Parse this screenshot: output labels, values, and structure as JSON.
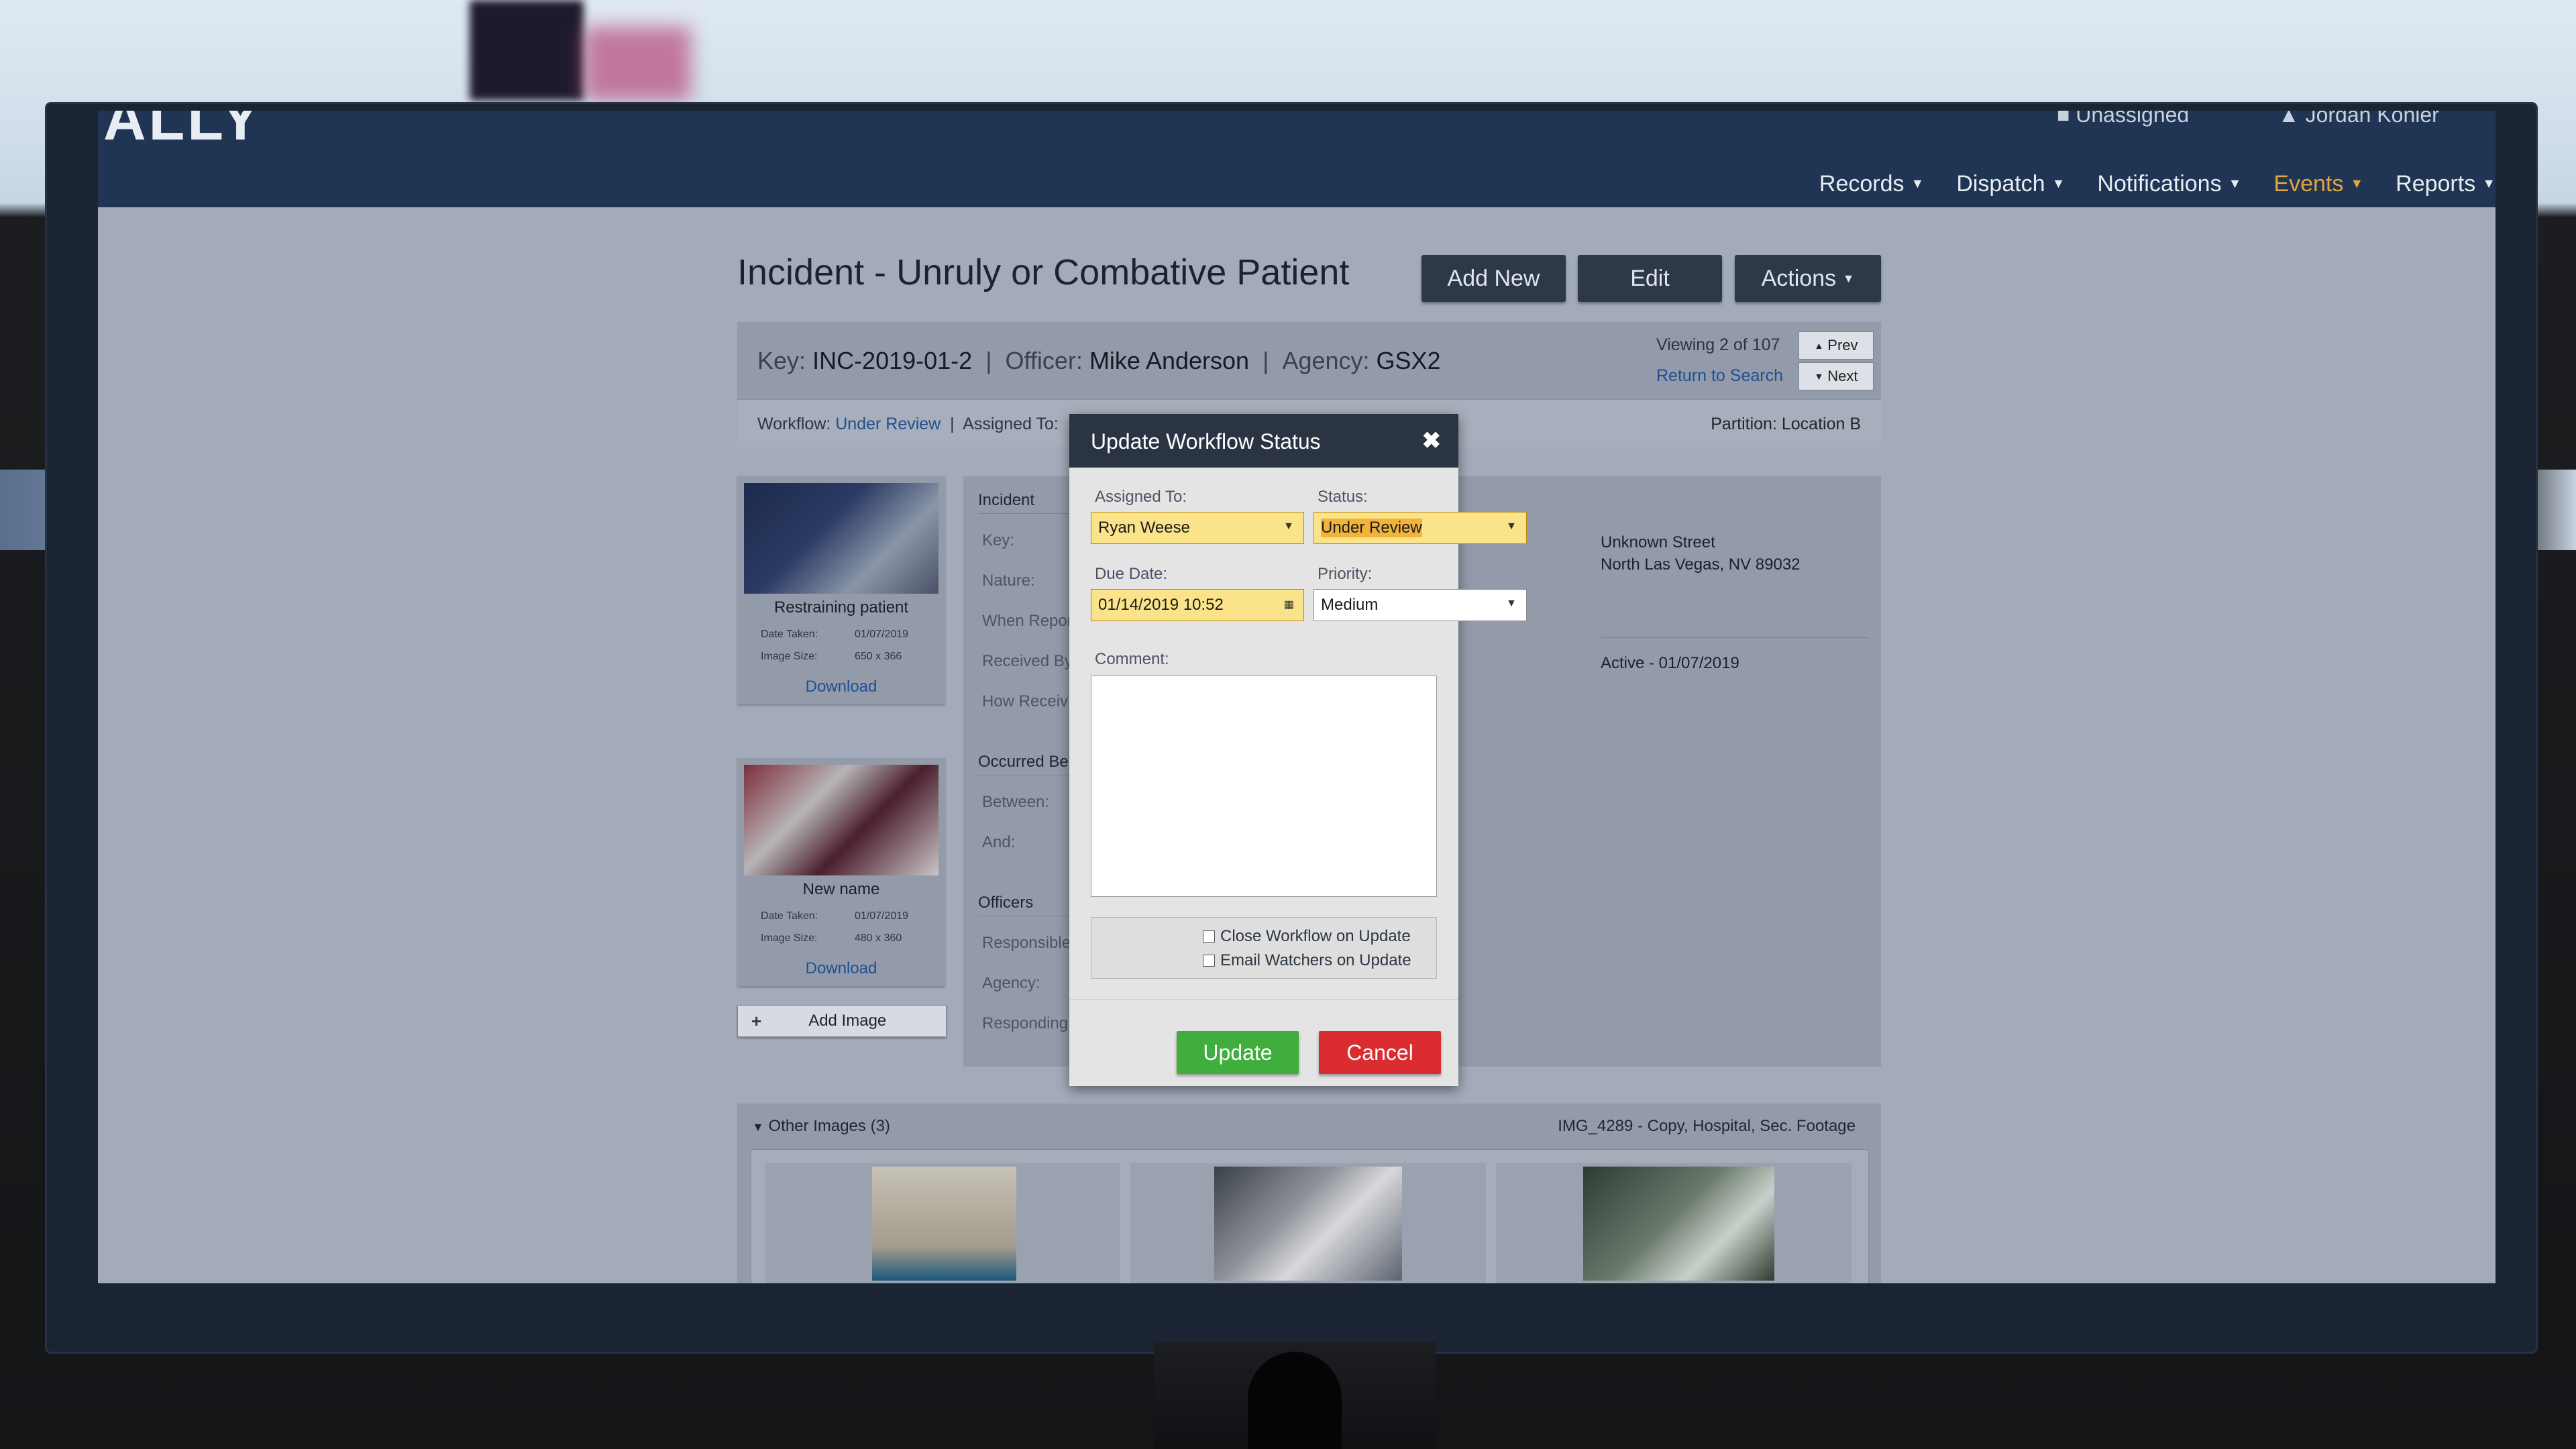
{
  "app": {
    "logo_text": "ALLY",
    "unassigned_label": "Unassigned",
    "user_name": "Jordan Kohler"
  },
  "nav": [
    {
      "label": "Records"
    },
    {
      "label": "Dispatch"
    },
    {
      "label": "Notifications"
    },
    {
      "label": "Events",
      "active": true
    },
    {
      "label": "Reports"
    }
  ],
  "page": {
    "title": "Incident - Unruly or Combative Patient",
    "buttons": {
      "add_new": "Add New",
      "edit": "Edit",
      "actions": "Actions"
    }
  },
  "record": {
    "key_label": "Key:",
    "key_value": "INC-2019-01-2",
    "officer_label": "Officer:",
    "officer_value": "Mike Anderson",
    "agency_label": "Agency:",
    "agency_value": "GSX2",
    "viewing": "Viewing 2 of 107",
    "return_to_search": "Return to Search",
    "prev": "Prev",
    "next": "Next",
    "workflow_label": "Workflow:",
    "workflow_value": "Under Review",
    "assigned_label": "Assigned To:",
    "partition": "Partition: Location B"
  },
  "images": [
    {
      "caption": "Restraining patient",
      "date_label": "Date Taken:",
      "date": "01/07/2019",
      "size_label": "Image Size:",
      "size": "650 x 366",
      "download": "Download"
    },
    {
      "caption": "New name",
      "date_label": "Date Taken:",
      "date": "01/07/2019",
      "size_label": "Image Size:",
      "size": "480 x 360",
      "download": "Download"
    }
  ],
  "add_image": "Add Image",
  "detail": {
    "incident_header": "Incident",
    "key_label": "Key:",
    "nature_label": "Nature:",
    "when_reported_label": "When Repor",
    "received_by_label": "Received By",
    "how_received_label": "How Receiv",
    "occurred_header": "Occurred Be",
    "between_label": "Between:",
    "and_label": "And:",
    "officers_header": "Officers",
    "responsible_label": "Responsible",
    "agency_label": "Agency:",
    "responding_label": "Responding",
    "address_line1": "Unknown Street",
    "address_line2": "North Las Vegas, NV 89032",
    "status_value": "Active - 01/07/2019"
  },
  "other_images": {
    "header": "Other Images",
    "count": "(3)",
    "right_text": "IMG_4289 - Copy, Hospital, Sec. Footage"
  },
  "modal": {
    "title": "Update Workflow Status",
    "assigned_to_label": "Assigned To:",
    "assigned_to_value": "Ryan Weese",
    "status_label": "Status:",
    "status_value": "Under Review",
    "due_date_label": "Due Date:",
    "due_date_value": "01/14/2019 10:52",
    "priority_label": "Priority:",
    "priority_value": "Medium",
    "comment_label": "Comment:",
    "close_workflow": "Close Workflow on Update",
    "email_watchers": "Email Watchers on Update",
    "update_btn": "Update",
    "cancel_btn": "Cancel",
    "colors": {
      "update": "#3fae3c",
      "cancel": "#db2c30",
      "highlight": "#fbe38a"
    }
  }
}
